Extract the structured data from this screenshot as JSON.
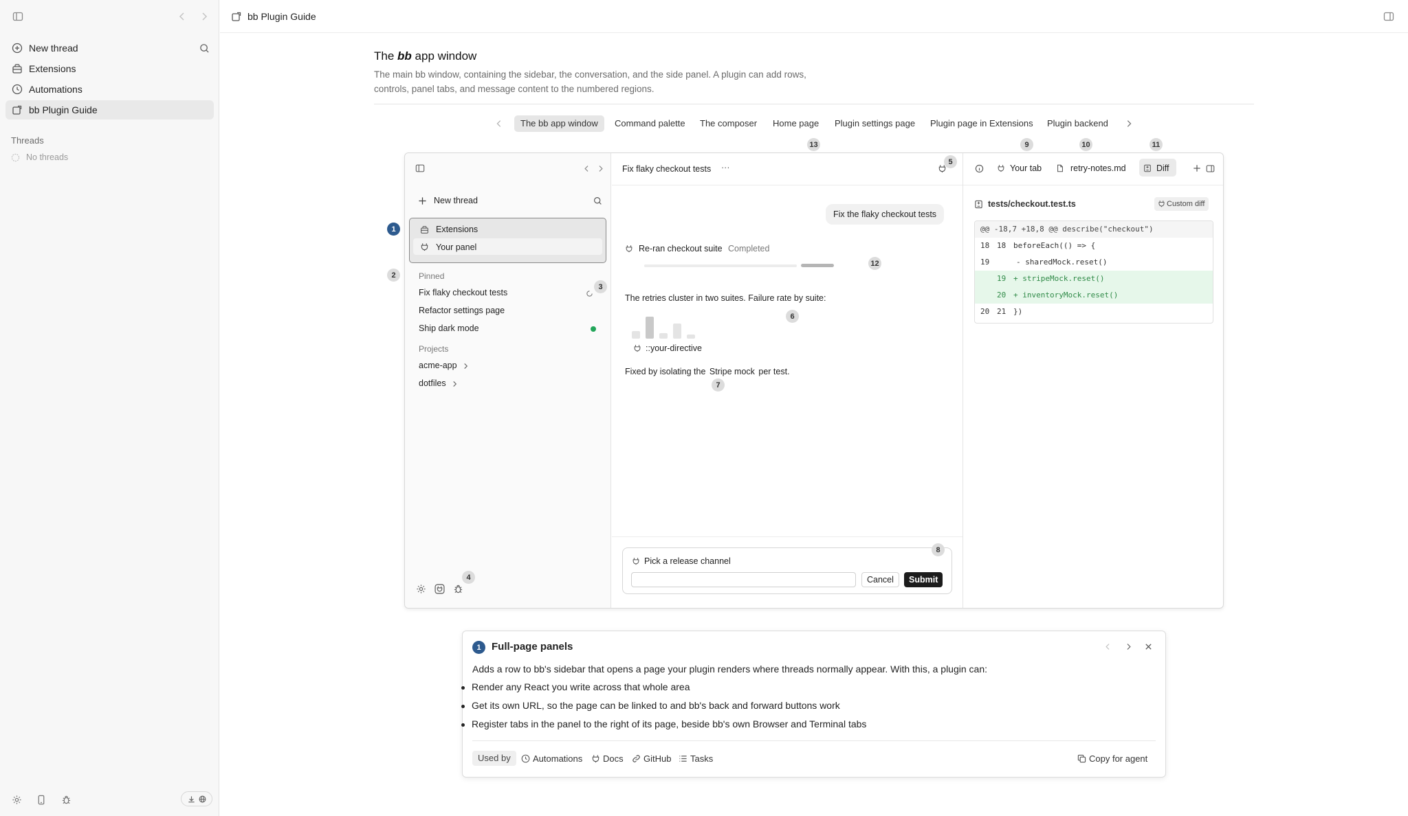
{
  "app": {
    "title": "bb Plugin Guide"
  },
  "sidebar": {
    "items": [
      {
        "label": "New thread",
        "icon": "plus-circle-icon"
      },
      {
        "label": "Extensions",
        "icon": "extensions-icon"
      },
      {
        "label": "Automations",
        "icon": "clock-icon"
      },
      {
        "label": "bb Plugin Guide",
        "icon": "plugin-page-icon",
        "active": true
      }
    ],
    "threads_heading": "Threads",
    "no_threads": "No threads"
  },
  "page": {
    "title_prefix": "The ",
    "title_em": "bb",
    "title_suffix": " app window",
    "description": "The main bb window, containing the sidebar, the conversation, and the side panel. A plugin can add rows, controls, panel tabs, and message content to the numbered regions."
  },
  "tabs": [
    "The bb app window",
    "Command palette",
    "The composer",
    "Home page",
    "Plugin settings page",
    "Plugin page in Extensions",
    "Plugin backend"
  ],
  "mock": {
    "sidebar": {
      "new_thread": "New thread",
      "nav": [
        "Extensions",
        "Your panel"
      ],
      "pinned_heading": "Pinned",
      "pinned": [
        "Fix flaky checkout tests",
        "Refactor settings page",
        "Ship dark mode"
      ],
      "projects_heading": "Projects",
      "projects": [
        "acme-app",
        "dotfiles"
      ]
    },
    "conversation": {
      "title": "Fix flaky checkout tests",
      "more": "···",
      "user_message": "Fix the flaky checkout tests",
      "tool_title": "Re-ran checkout suite",
      "tool_status": "Completed",
      "progress": 0.72,
      "text1": "The retries cluster in two suites. Failure rate by suite:",
      "bars": [
        0.35,
        1.0,
        0.25,
        0.7,
        0.18
      ],
      "directive": "::your-directive",
      "text2_before": "Fixed by isolating the ",
      "text2_code": "Stripe mock",
      "text2_after": " per test.",
      "prompt_label": "Pick a release channel",
      "cancel": "Cancel",
      "submit": "Submit"
    },
    "panel": {
      "tabs": [
        "Your tab",
        "retry-notes.md",
        "Diff"
      ],
      "file": "tests/checkout.test.ts",
      "custom_diff": "Custom diff",
      "hunk": "@@ -18,7 +18,8 @@ describe(\"checkout\")",
      "lines": [
        {
          "old": "18",
          "new": "18",
          "text": "beforeEach(() => {",
          "type": "ctx"
        },
        {
          "old": "19",
          "new": "",
          "text": "- sharedMock.reset()",
          "type": "del"
        },
        {
          "old": "",
          "new": "19",
          "text": "+ stripeMock.reset()",
          "type": "add"
        },
        {
          "old": "",
          "new": "20",
          "text": "+ inventoryMock.reset()",
          "type": "add"
        },
        {
          "old": "20",
          "new": "21",
          "text": "})",
          "type": "ctx"
        }
      ]
    },
    "badges": [
      "1",
      "2",
      "3",
      "4",
      "5",
      "6",
      "7",
      "8",
      "9",
      "10",
      "11",
      "12",
      "13"
    ]
  },
  "card": {
    "number": "1",
    "title": "Full-page panels",
    "intro": "Adds a row to bb's sidebar that opens a page your plugin renders where threads normally appear. With this, a plugin can:",
    "bullets": [
      "Render any React you write across that whole area",
      "Get its own URL, so the page can be linked to and bb's back and forward buttons work",
      "Register tabs in the panel to the right of its page, beside bb's own Browser and Terminal tabs"
    ],
    "used_by": "Used by",
    "links": [
      "Automations",
      "Docs",
      "GitHub",
      "Tasks"
    ],
    "copy": "Copy for agent"
  }
}
